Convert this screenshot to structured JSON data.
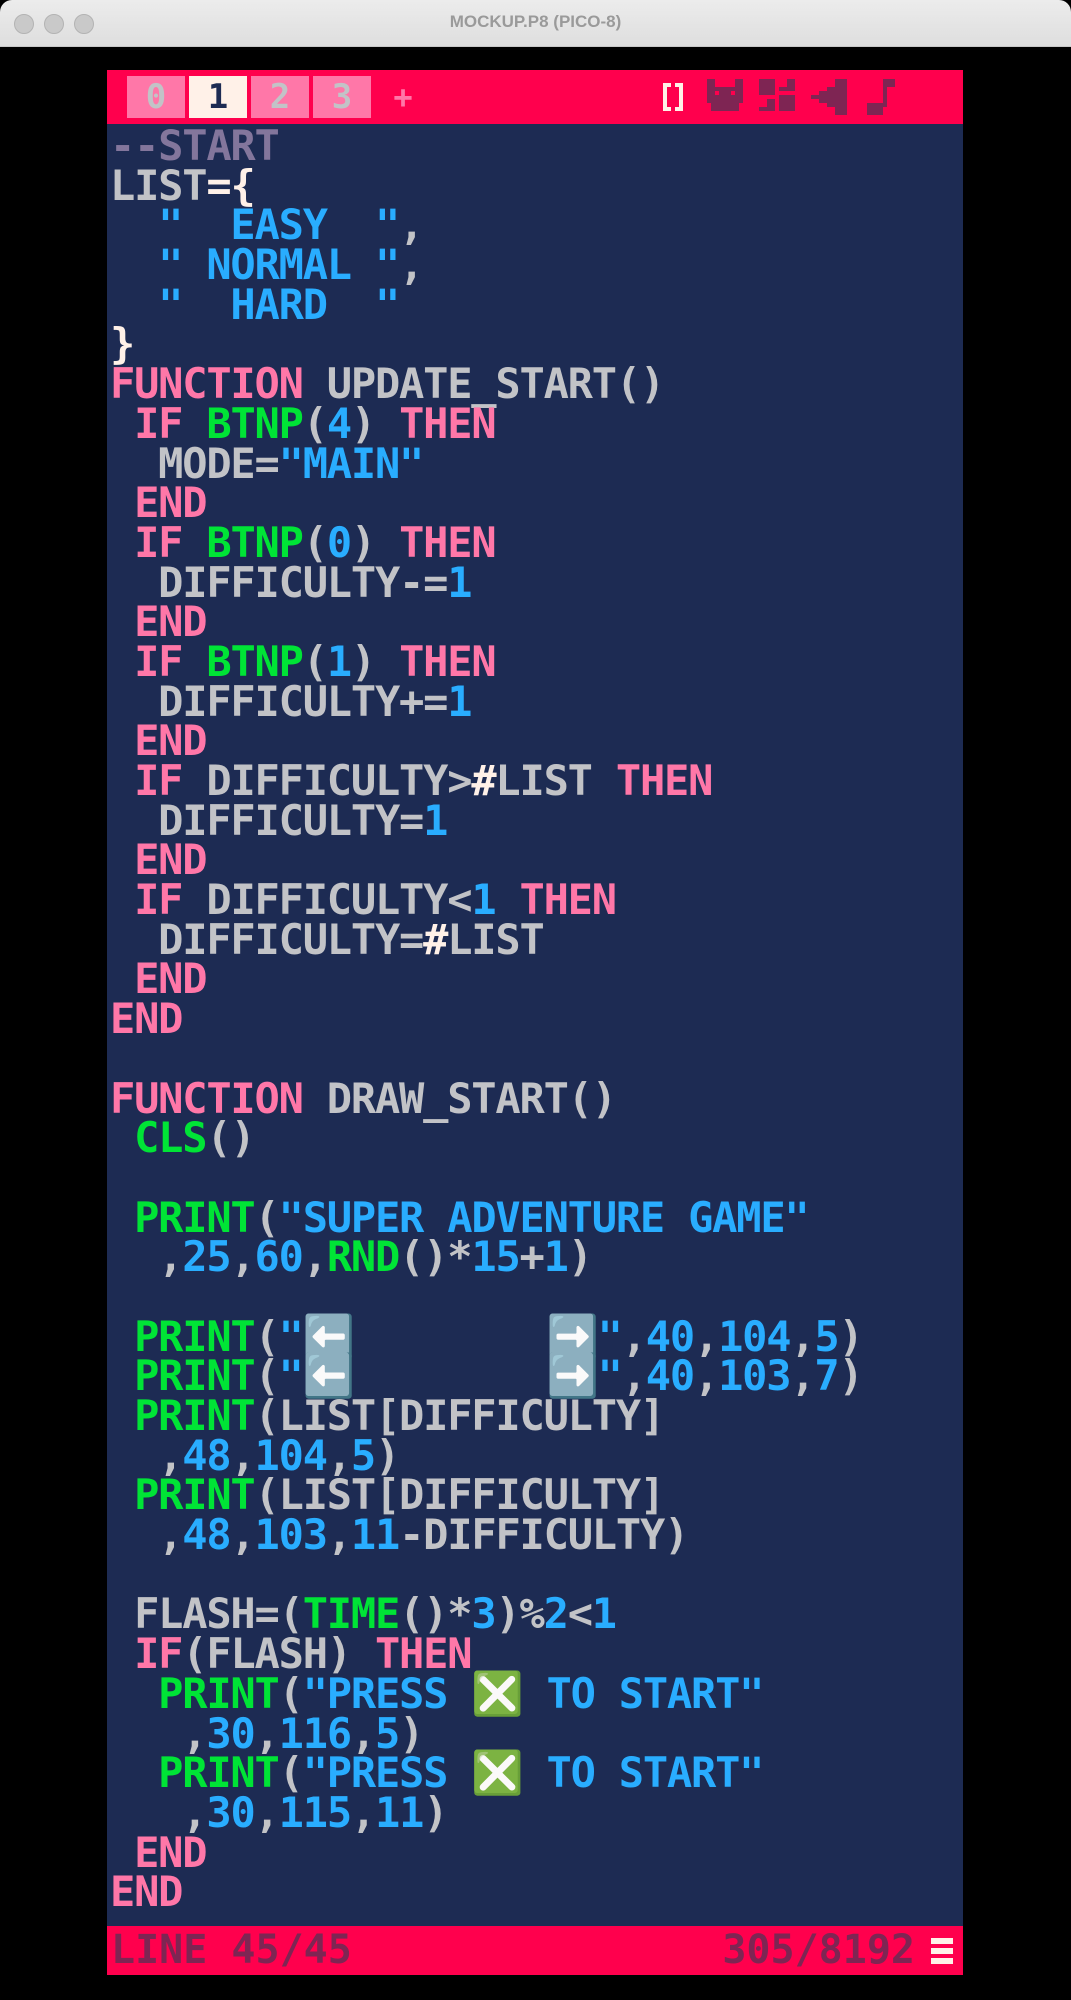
{
  "window": {
    "title": "MOCKUP.P8 (PICO-8)"
  },
  "tabs": [
    {
      "label": "0"
    },
    {
      "label": "1"
    },
    {
      "label": "2"
    },
    {
      "label": "3"
    }
  ],
  "add_tab_label": "+",
  "editor_icons": [
    "code-editor-icon",
    "sprite-editor-icon",
    "map-editor-icon",
    "sfx-editor-icon",
    "music-editor-icon"
  ],
  "colors": {
    "accent": "#ff004d",
    "background": "#1d2b53",
    "keyword": "#ff77a8",
    "builtin": "#00e436",
    "string": "#29adff",
    "comment": "#83769c",
    "identifier": "#c2c3c7"
  },
  "code_lines": [
    [
      [
        "cm",
        "--START"
      ]
    ],
    [
      [
        "id",
        "LIST"
      ],
      [
        "op",
        "={"
      ]
    ],
    [
      [
        "st",
        "  \"  EASY  \""
      ],
      [
        "id",
        ","
      ]
    ],
    [
      [
        "st",
        "  \" NORMAL \""
      ],
      [
        "id",
        ","
      ]
    ],
    [
      [
        "st",
        "  \"  HARD  \""
      ]
    ],
    [
      [
        "op",
        "}"
      ]
    ],
    [
      [
        "kw",
        "FUNCTION"
      ],
      [
        "id",
        " UPDATE_START()"
      ]
    ],
    [
      [
        "kw",
        " IF "
      ],
      [
        "fn",
        "BTNP"
      ],
      [
        "id",
        "("
      ],
      [
        "nm",
        "4"
      ],
      [
        "id",
        ")"
      ],
      [
        "kw",
        " THEN"
      ]
    ],
    [
      [
        "id",
        "  MODE="
      ],
      [
        "st",
        "\"MAIN\""
      ]
    ],
    [
      [
        "kw",
        " END"
      ]
    ],
    [
      [
        "kw",
        " IF "
      ],
      [
        "fn",
        "BTNP"
      ],
      [
        "id",
        "("
      ],
      [
        "nm",
        "0"
      ],
      [
        "id",
        ")"
      ],
      [
        "kw",
        " THEN"
      ]
    ],
    [
      [
        "id",
        "  DIFFICULTY-="
      ],
      [
        "nm",
        "1"
      ]
    ],
    [
      [
        "kw",
        " END"
      ]
    ],
    [
      [
        "kw",
        " IF "
      ],
      [
        "fn",
        "BTNP"
      ],
      [
        "id",
        "("
      ],
      [
        "nm",
        "1"
      ],
      [
        "id",
        ")"
      ],
      [
        "kw",
        " THEN"
      ]
    ],
    [
      [
        "id",
        "  DIFFICULTY+="
      ],
      [
        "nm",
        "1"
      ]
    ],
    [
      [
        "kw",
        " END"
      ]
    ],
    [
      [
        "kw",
        " IF "
      ],
      [
        "id",
        "DIFFICULTY>"
      ],
      [
        "op",
        "#"
      ],
      [
        "id",
        "LIST"
      ],
      [
        "kw",
        " THEN"
      ]
    ],
    [
      [
        "id",
        "  DIFFICULTY="
      ],
      [
        "nm",
        "1"
      ]
    ],
    [
      [
        "kw",
        " END"
      ]
    ],
    [
      [
        "kw",
        " IF "
      ],
      [
        "id",
        "DIFFICULTY<"
      ],
      [
        "nm",
        "1"
      ],
      [
        "kw",
        " THEN"
      ]
    ],
    [
      [
        "id",
        "  DIFFICULTY="
      ],
      [
        "op",
        "#"
      ],
      [
        "id",
        "LIST"
      ]
    ],
    [
      [
        "kw",
        " END"
      ]
    ],
    [
      [
        "kw",
        "END"
      ]
    ],
    [
      [
        "id",
        ""
      ]
    ],
    [
      [
        "kw",
        "FUNCTION"
      ],
      [
        "id",
        " DRAW_START()"
      ]
    ],
    [
      [
        "fn",
        " CLS"
      ],
      [
        "id",
        "()"
      ]
    ],
    [
      [
        "id",
        ""
      ]
    ],
    [
      [
        "fn",
        " PRINT"
      ],
      [
        "id",
        "("
      ],
      [
        "st",
        "\"SUPER ADVENTURE GAME\""
      ]
    ],
    [
      [
        "id",
        "  ,"
      ],
      [
        "nm",
        "25"
      ],
      [
        "id",
        ","
      ],
      [
        "nm",
        "60"
      ],
      [
        "id",
        ","
      ],
      [
        "fn",
        "RND"
      ],
      [
        "id",
        "()*"
      ],
      [
        "nm",
        "15"
      ],
      [
        "id",
        "+"
      ],
      [
        "nm",
        "1"
      ],
      [
        "id",
        ")"
      ]
    ],
    [
      [
        "id",
        ""
      ]
    ],
    [
      [
        "fn",
        " PRINT"
      ],
      [
        "id",
        "("
      ],
      [
        "st",
        "\"⬅️        ➡️\""
      ],
      [
        "id",
        ","
      ],
      [
        "nm",
        "40"
      ],
      [
        "id",
        ","
      ],
      [
        "nm",
        "104"
      ],
      [
        "id",
        ","
      ],
      [
        "nm",
        "5"
      ],
      [
        "id",
        ")"
      ]
    ],
    [
      [
        "fn",
        " PRINT"
      ],
      [
        "id",
        "("
      ],
      [
        "st",
        "\"⬅️        ➡️\""
      ],
      [
        "id",
        ","
      ],
      [
        "nm",
        "40"
      ],
      [
        "id",
        ","
      ],
      [
        "nm",
        "103"
      ],
      [
        "id",
        ","
      ],
      [
        "nm",
        "7"
      ],
      [
        "id",
        ")"
      ]
    ],
    [
      [
        "fn",
        " PRINT"
      ],
      [
        "id",
        "(LIST[DIFFICULTY]"
      ]
    ],
    [
      [
        "id",
        "  ,"
      ],
      [
        "nm",
        "48"
      ],
      [
        "id",
        ","
      ],
      [
        "nm",
        "104"
      ],
      [
        "id",
        ","
      ],
      [
        "nm",
        "5"
      ],
      [
        "id",
        ")"
      ]
    ],
    [
      [
        "fn",
        " PRINT"
      ],
      [
        "id",
        "(LIST[DIFFICULTY]"
      ]
    ],
    [
      [
        "id",
        "  ,"
      ],
      [
        "nm",
        "48"
      ],
      [
        "id",
        ","
      ],
      [
        "nm",
        "103"
      ],
      [
        "id",
        ","
      ],
      [
        "nm",
        "11"
      ],
      [
        "id",
        "-DIFFICULTY)"
      ]
    ],
    [
      [
        "id",
        ""
      ]
    ],
    [
      [
        "id",
        " FLASH=("
      ],
      [
        "fn",
        "TIME"
      ],
      [
        "id",
        "()*"
      ],
      [
        "nm",
        "3"
      ],
      [
        "id",
        ")%"
      ],
      [
        "nm",
        "2"
      ],
      [
        "id",
        "<"
      ],
      [
        "nm",
        "1"
      ]
    ],
    [
      [
        "kw",
        " IF"
      ],
      [
        "id",
        "(FLASH)"
      ],
      [
        "kw",
        " THEN"
      ]
    ],
    [
      [
        "fn",
        "  PRINT"
      ],
      [
        "id",
        "("
      ],
      [
        "st",
        "\"PRESS ❎ TO START\""
      ]
    ],
    [
      [
        "id",
        "   ,"
      ],
      [
        "nm",
        "30"
      ],
      [
        "id",
        ","
      ],
      [
        "nm",
        "116"
      ],
      [
        "id",
        ","
      ],
      [
        "nm",
        "5"
      ],
      [
        "id",
        ")"
      ]
    ],
    [
      [
        "fn",
        "  PRINT"
      ],
      [
        "id",
        "("
      ],
      [
        "st",
        "\"PRESS ❎ TO START\""
      ]
    ],
    [
      [
        "id",
        "   ,"
      ],
      [
        "nm",
        "30"
      ],
      [
        "id",
        ","
      ],
      [
        "nm",
        "115"
      ],
      [
        "id",
        ","
      ],
      [
        "nm",
        "11"
      ],
      [
        "id",
        ")"
      ]
    ],
    [
      [
        "kw",
        " END"
      ]
    ],
    [
      [
        "kw",
        "END"
      ]
    ]
  ],
  "status": {
    "line": "LINE 45/45",
    "tokens": "305/8192"
  }
}
